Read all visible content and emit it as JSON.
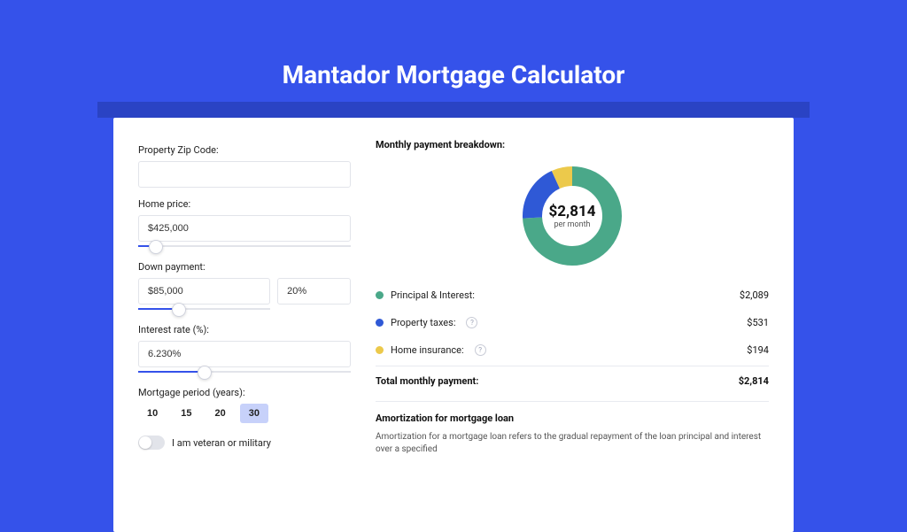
{
  "page": {
    "title": "Mantador Mortgage Calculator"
  },
  "form": {
    "zip_label": "Property Zip Code:",
    "zip_value": "",
    "home_price_label": "Home price:",
    "home_price_value": "$425,000",
    "home_price_slider": {
      "percent": 8
    },
    "down_payment_label": "Down payment:",
    "down_payment_value": "$85,000",
    "down_payment_pct": "20%",
    "down_payment_slider": {
      "percent": 20
    },
    "interest_label": "Interest rate (%):",
    "interest_value": "6.230%",
    "interest_slider": {
      "percent": 31
    },
    "period_label": "Mortgage period (years):",
    "periods": [
      "10",
      "15",
      "20",
      "30"
    ],
    "period_active_index": 3,
    "veteran_label": "I am veteran or military"
  },
  "breakdown": {
    "title": "Monthly payment breakdown:",
    "donut_amount": "$2,814",
    "donut_sub": "per month",
    "items": [
      {
        "label": "Principal & Interest:",
        "value": "$2,089",
        "help": false
      },
      {
        "label": "Property taxes:",
        "value": "$531",
        "help": true
      },
      {
        "label": "Home insurance:",
        "value": "$194",
        "help": true
      }
    ],
    "total_label": "Total monthly payment:",
    "total_value": "$2,814"
  },
  "amortization": {
    "title": "Amortization for mortgage loan",
    "text": "Amortization for a mortgage loan refers to the gradual repayment of the loan principal and interest over a specified"
  },
  "chart_data": {
    "type": "pie",
    "title": "Monthly payment breakdown",
    "total": 2814,
    "series": [
      {
        "name": "Principal & Interest",
        "value": 2089,
        "color": "#4aa889"
      },
      {
        "name": "Property taxes",
        "value": 531,
        "color": "#2f59d6"
      },
      {
        "name": "Home insurance",
        "value": 194,
        "color": "#ecc94b"
      }
    ]
  }
}
